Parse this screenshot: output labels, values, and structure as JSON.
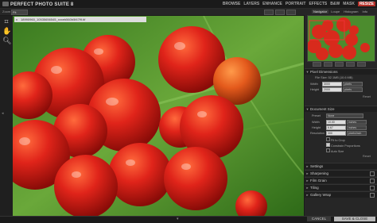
{
  "app": {
    "title": "PERFECT PHOTO SUITE 8"
  },
  "modes": [
    {
      "label": "BROWSE",
      "active": false
    },
    {
      "label": "LAYERS",
      "active": false
    },
    {
      "label": "ENHANCE",
      "active": false
    },
    {
      "label": "PORTRAIT",
      "active": false
    },
    {
      "label": "EFFECTS",
      "active": false
    },
    {
      "label": "B&W",
      "active": false
    },
    {
      "label": "MASK",
      "active": false
    },
    {
      "label": "RESIZE",
      "active": true
    }
  ],
  "zoom": {
    "label": "Zoom",
    "value": "Fit"
  },
  "document_tab": {
    "title": "18990960_10535656545_xxxeb560b5f47f9.tif",
    "close": "x"
  },
  "navigator": {
    "tabs": [
      "Navigator",
      "Loupe",
      "Histogram",
      "Info"
    ]
  },
  "sections": {
    "pixel_dimensions": "Pixel Dimensions",
    "document_size": "Document Size",
    "settings": "Settings",
    "sharpening": "Sharpening",
    "film_grain": "Film Grain",
    "tiling": "Tiling",
    "gallery_wrap": "Gallery Wrap"
  },
  "pixel_dimensions": {
    "file_size": "File Size: 52.1MB (10.6 MB)",
    "width_label": "Width",
    "width_value": "3000",
    "width_unit": "pixels",
    "height_label": "Height",
    "height_value": "2000",
    "height_unit": "pixels",
    "reset": "Reset"
  },
  "document_size": {
    "preset_label": "Preset",
    "preset_value": "None",
    "width_label": "Width",
    "width_value": "10.00",
    "width_unit": "inches",
    "height_label": "Height",
    "height_value": "6.67",
    "height_unit": "inches",
    "resolution_label": "Resolution",
    "resolution_value": "300",
    "resolution_unit": "pixels/inch",
    "fit_to_crop": "Fit to Crop",
    "constrain": "Constrain Proportions",
    "auto_size": "Auto Size",
    "reset": "Reset"
  },
  "buttons": {
    "cancel": "CANCEL",
    "save_close": "SAVE & CLOSE"
  }
}
